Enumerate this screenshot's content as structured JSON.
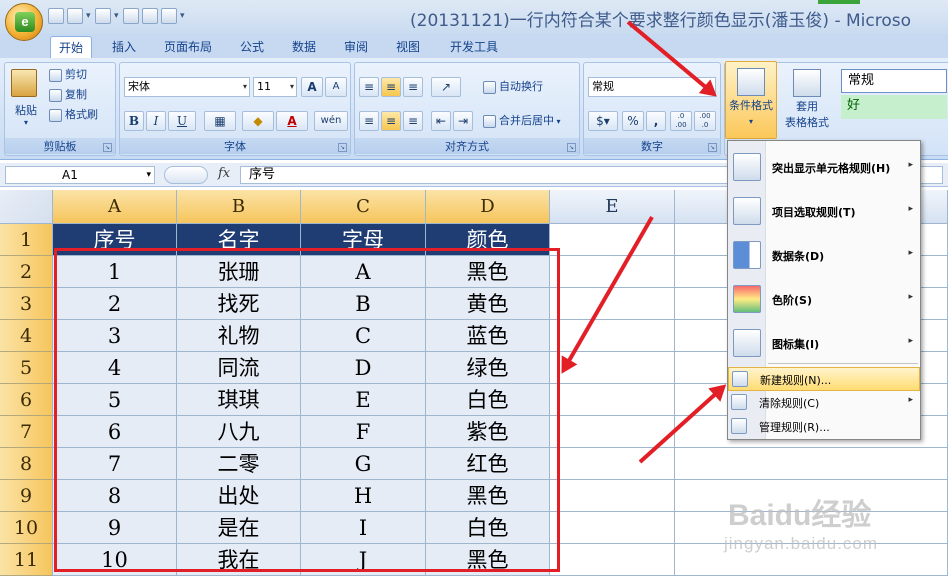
{
  "window": {
    "title": "(20131121)一行内符合某个要求整行颜色显示(潘玉俊) - Microso"
  },
  "office_button": {
    "logo_letter": "e"
  },
  "ribbon_tabs": [
    "开始",
    "插入",
    "页面布局",
    "公式",
    "数据",
    "审阅",
    "视图",
    "开发工具"
  ],
  "active_tab": "开始",
  "clipboard": {
    "paste": "粘贴",
    "cut": "剪切",
    "copy": "复制",
    "format_painter": "格式刷",
    "group_title": "剪贴板"
  },
  "font": {
    "name": "宋体",
    "size": "11",
    "grow": "A",
    "shrink": "A",
    "bold": "B",
    "italic": "I",
    "underline": "U",
    "font_color": "A",
    "phonetic": "wén",
    "group_title": "字体"
  },
  "alignment": {
    "wrap_text": "自动换行",
    "merge_center": "合并后居中",
    "group_title": "对齐方式"
  },
  "number": {
    "format": "常规",
    "percent": "%",
    "comma": ",",
    "inc_decimal": ".0 .00",
    "dec_decimal": ".00 .0",
    "group_title": "数字"
  },
  "styles": {
    "conditional_formatting": "条件格式",
    "format_as_table_line1": "套用",
    "format_as_table_line2": "表格格式",
    "style_normal": "常规",
    "style_good": "好"
  },
  "formula_bar": {
    "name_box": "A1",
    "fx": "fx",
    "content": "序号"
  },
  "columns": [
    "A",
    "B",
    "C",
    "D",
    "E"
  ],
  "rows": [
    "1",
    "2",
    "3",
    "4",
    "5",
    "6",
    "7",
    "8",
    "9",
    "10",
    "11"
  ],
  "table": {
    "headers": [
      "序号",
      "名字",
      "字母",
      "颜色"
    ],
    "records": [
      [
        "1",
        "张珊",
        "A",
        "黑色"
      ],
      [
        "2",
        "找死",
        "B",
        "黄色"
      ],
      [
        "3",
        "礼物",
        "C",
        "蓝色"
      ],
      [
        "4",
        "同流",
        "D",
        "绿色"
      ],
      [
        "5",
        "琪琪",
        "E",
        "白色"
      ],
      [
        "6",
        "八九",
        "F",
        "紫色"
      ],
      [
        "7",
        "二零",
        "G",
        "红色"
      ],
      [
        "8",
        "出处",
        "H",
        "黑色"
      ],
      [
        "9",
        "是在",
        "I",
        "白色"
      ],
      [
        "10",
        "我在",
        "J",
        "黑色"
      ]
    ]
  },
  "cf_menu": {
    "highlight_rules": "突出显示单元格规则(H)",
    "top_bottom": "项目选取规则(T)",
    "data_bars": "数据条(D)",
    "color_scales": "色阶(S)",
    "icon_sets": "图标集(I)",
    "new_rule": "新建规则(N)...",
    "clear_rules": "清除规则(C)",
    "manage_rules": "管理规则(R)..."
  },
  "watermark": {
    "brand": "Baidu经验",
    "url": "jingyan.baidu.com"
  },
  "colors": {
    "header_fill": "#1f3d73",
    "header_text": "#ffffff",
    "selection_fill": "#e6ecf6",
    "annotation_red": "#e21f26",
    "menu_highlight": "#ffdc73"
  }
}
